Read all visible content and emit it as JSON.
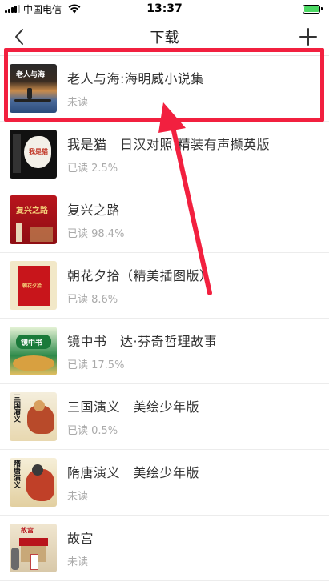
{
  "status_bar": {
    "carrier": "中国电信",
    "time": "13:37"
  },
  "nav": {
    "title": "下载"
  },
  "books": [
    {
      "title": "老人与海:海明威小说集",
      "status": "未读",
      "cover_text": "老人与海"
    },
    {
      "title": "我是猫　日汉对照·精装有声撷英版",
      "status": "已读 2.5%",
      "cover_text": "我是猫"
    },
    {
      "title": "复兴之路",
      "status": "已读 98.4%",
      "cover_text": "复兴之路"
    },
    {
      "title": "朝花夕拾（精美插图版）",
      "status": "已读 8.6%",
      "cover_text": "朝花夕拾"
    },
    {
      "title": "镜中书　达·芬奇哲理故事",
      "status": "已读 17.5%",
      "cover_text": "镜中书"
    },
    {
      "title": "三国演义　美绘少年版",
      "status": "已读 0.5%",
      "cover_text": "三国演义"
    },
    {
      "title": "隋唐演义　美绘少年版",
      "status": "未读",
      "cover_text": "隋唐演义"
    },
    {
      "title": "故宫",
      "status": "未读",
      "cover_text": "故宫"
    }
  ],
  "colors": {
    "highlight": "#f2203f",
    "battery": "#4cd964"
  }
}
